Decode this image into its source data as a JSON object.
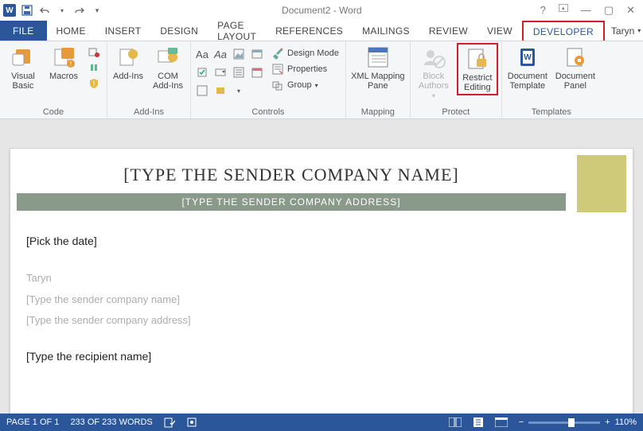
{
  "window": {
    "title": "Document2 - Word"
  },
  "qat": {
    "icons": [
      "word",
      "save",
      "undo",
      "redo",
      "customize"
    ]
  },
  "tabs": {
    "file": "FILE",
    "list": [
      "HOME",
      "INSERT",
      "DESIGN",
      "PAGE LAYOUT",
      "REFERENCES",
      "MAILINGS",
      "REVIEW",
      "VIEW",
      "DEVELOPER"
    ],
    "active": "DEVELOPER",
    "user": "Taryn"
  },
  "ribbon": {
    "code": {
      "label": "Code",
      "visual_basic": "Visual\nBasic",
      "macros": "Macros"
    },
    "addins": {
      "label": "Add-Ins",
      "addins": "Add-Ins",
      "com": "COM\nAdd-Ins"
    },
    "controls": {
      "label": "Controls",
      "design_mode": "Design Mode",
      "properties": "Properties",
      "group": "Group"
    },
    "mapping": {
      "label": "Mapping",
      "xml": "XML Mapping\nPane"
    },
    "protect": {
      "label": "Protect",
      "block": "Block\nAuthors",
      "restrict": "Restrict\nEditing"
    },
    "templates": {
      "label": "Templates",
      "template": "Document\nTemplate",
      "panel": "Document\nPanel"
    }
  },
  "document": {
    "company_name": "[TYPE THE SENDER COMPANY NAME]",
    "company_addr": "[TYPE THE SENDER COMPANY ADDRESS]",
    "pick_date": "[Pick the date]",
    "sender_name": "Taryn",
    "sender_company": "[Type the sender company name]",
    "sender_addr": "[Type the sender company address]",
    "recipient": "[Type the recipient name]"
  },
  "status": {
    "page": "PAGE 1 OF 1",
    "words": "233 OF 233 WORDS",
    "zoom": "110%"
  }
}
